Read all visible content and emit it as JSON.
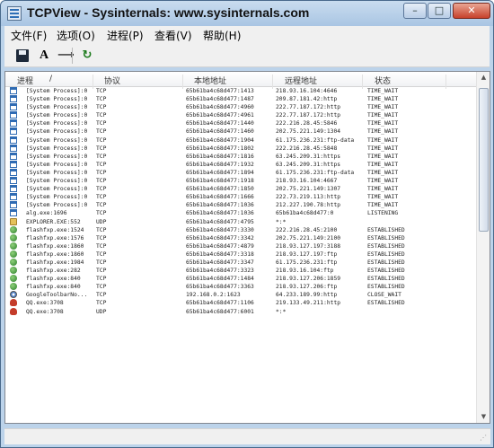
{
  "window": {
    "title": "TCPView - Sysinternals: www.sysinternals.com",
    "minimize_icon": "minimize-icon",
    "maximize_icon": "maximize-icon",
    "close_icon": "close-icon"
  },
  "window_controls": {
    "minimize": "–",
    "maximize": "□",
    "close": "✕"
  },
  "menu": [
    "文件(F)",
    "选项(O)",
    "进程(P)",
    "查看(V)",
    "帮助(H)"
  ],
  "toolbar": {
    "save_icon": "save-icon",
    "font_label": "A",
    "resolve_label": "⟶",
    "refresh_label": "↻"
  },
  "columns": [
    "进程",
    "/",
    "协议",
    "本地地址",
    "远程地址",
    "状态"
  ],
  "rows": [
    {
      "icon": "win",
      "process": "[System Process]:0",
      "protocol": "TCP",
      "local": "65b61ba4c68d477:1413",
      "remote": "218.93.16.104:4646",
      "state": "TIME_WAIT"
    },
    {
      "icon": "win",
      "process": "[System Process]:0",
      "protocol": "TCP",
      "local": "65b61ba4c68d477:1487",
      "remote": "209.87.181.42:http",
      "state": "TIME_WAIT"
    },
    {
      "icon": "win",
      "process": "[System Process]:0",
      "protocol": "TCP",
      "local": "65b61ba4c68d477:4960",
      "remote": "222.77.187.172:http",
      "state": "TIME_WAIT"
    },
    {
      "icon": "win",
      "process": "[System Process]:0",
      "protocol": "TCP",
      "local": "65b61ba4c68d477:4961",
      "remote": "222.77.187.172:http",
      "state": "TIME_WAIT"
    },
    {
      "icon": "win",
      "process": "[System Process]:0",
      "protocol": "TCP",
      "local": "65b61ba4c68d477:1440",
      "remote": "222.216.28.45:5846",
      "state": "TIME_WAIT"
    },
    {
      "icon": "win",
      "process": "[System Process]:0",
      "protocol": "TCP",
      "local": "65b61ba4c68d477:1460",
      "remote": "202.75.221.149:1304",
      "state": "TIME_WAIT"
    },
    {
      "icon": "win",
      "process": "[System Process]:0",
      "protocol": "TCP",
      "local": "65b61ba4c68d477:1904",
      "remote": "61.175.236.231:ftp-data",
      "state": "TIME_WAIT"
    },
    {
      "icon": "win",
      "process": "[System Process]:0",
      "protocol": "TCP",
      "local": "65b61ba4c68d477:1802",
      "remote": "222.216.28.45:5848",
      "state": "TIME_WAIT"
    },
    {
      "icon": "win",
      "process": "[System Process]:0",
      "protocol": "TCP",
      "local": "65b61ba4c68d477:1816",
      "remote": "63.245.209.31:https",
      "state": "TIME_WAIT"
    },
    {
      "icon": "win",
      "process": "[System Process]:0",
      "protocol": "TCP",
      "local": "65b61ba4c68d477:1932",
      "remote": "63.245.209.31:https",
      "state": "TIME_WAIT"
    },
    {
      "icon": "win",
      "process": "[System Process]:0",
      "protocol": "TCP",
      "local": "65b61ba4c68d477:1894",
      "remote": "61.175.236.231:ftp-data",
      "state": "TIME_WAIT"
    },
    {
      "icon": "win",
      "process": "[System Process]:0",
      "protocol": "TCP",
      "local": "65b61ba4c68d477:1918",
      "remote": "218.93.16.104:4667",
      "state": "TIME_WAIT"
    },
    {
      "icon": "win",
      "process": "[System Process]:0",
      "protocol": "TCP",
      "local": "65b61ba4c68d477:1850",
      "remote": "202.75.221.149:1307",
      "state": "TIME_WAIT"
    },
    {
      "icon": "win",
      "process": "[System Process]:0",
      "protocol": "TCP",
      "local": "65b61ba4c68d477:1666",
      "remote": "222.73.219.113:http",
      "state": "TIME_WAIT"
    },
    {
      "icon": "win",
      "process": "[System Process]:0",
      "protocol": "TCP",
      "local": "65b61ba4c68d477:1036",
      "remote": "212.227.190.78:http",
      "state": "TIME_WAIT"
    },
    {
      "icon": "win",
      "process": "alg.exe:1696",
      "protocol": "TCP",
      "local": "65b61ba4c68d477:1036",
      "remote": "65b61ba4c68d477:0",
      "state": "LISTENING"
    },
    {
      "icon": "explorer",
      "process": "EXPLORER.EXE:552",
      "protocol": "UDP",
      "local": "65b61ba4c68d477:4795",
      "remote": "*:*",
      "state": ""
    },
    {
      "icon": "flash",
      "process": "flashfxp.exe:1524",
      "protocol": "TCP",
      "local": "65b61ba4c68d477:3330",
      "remote": "222.216.28.45:2100",
      "state": "ESTABLISHED"
    },
    {
      "icon": "flash",
      "process": "flashfxp.exe:1576",
      "protocol": "TCP",
      "local": "65b61ba4c68d477:3342",
      "remote": "202.75.221.149:2100",
      "state": "ESTABLISHED"
    },
    {
      "icon": "flash",
      "process": "flashfxp.exe:1860",
      "protocol": "TCP",
      "local": "65b61ba4c68d477:4879",
      "remote": "218.93.127.197:3188",
      "state": "ESTABLISHED"
    },
    {
      "icon": "flash",
      "process": "flashfxp.exe:1860",
      "protocol": "TCP",
      "local": "65b61ba4c68d477:3318",
      "remote": "218.93.127.197:ftp",
      "state": "ESTABLISHED"
    },
    {
      "icon": "flash",
      "process": "flashfxp.exe:1984",
      "protocol": "TCP",
      "local": "65b61ba4c68d477:3347",
      "remote": "61.175.236.231:ftp",
      "state": "ESTABLISHED"
    },
    {
      "icon": "flash",
      "process": "flashfxp.exe:282",
      "protocol": "TCP",
      "local": "65b61ba4c68d477:3323",
      "remote": "218.93.16.104:ftp",
      "state": "ESTABLISHED"
    },
    {
      "icon": "flash",
      "process": "flashfxp.exe:840",
      "protocol": "TCP",
      "local": "65b61ba4c68d477:1484",
      "remote": "218.93.127.206:1859",
      "state": "ESTABLISHED"
    },
    {
      "icon": "flash",
      "process": "flashfxp.exe:840",
      "protocol": "TCP",
      "local": "65b61ba4c68d477:3363",
      "remote": "218.93.127.206:ftp",
      "state": "ESTABLISHED"
    },
    {
      "icon": "google",
      "process": "GoogleToolbarNo...",
      "protocol": "TCP",
      "local": "192.168.0.2:1623",
      "remote": "64.233.189.99:http",
      "state": "CLOSE_WAIT"
    },
    {
      "icon": "qq",
      "process": "QQ.exe:3708",
      "protocol": "TCP",
      "local": "65b61ba4c68d477:1106",
      "remote": "219.133.49.211:http",
      "state": "ESTABLISHED"
    },
    {
      "icon": "qq",
      "process": "QQ.exe:3708",
      "protocol": "UDP",
      "local": "65b61ba4c68d477:6001",
      "remote": "*:*",
      "state": ""
    }
  ]
}
